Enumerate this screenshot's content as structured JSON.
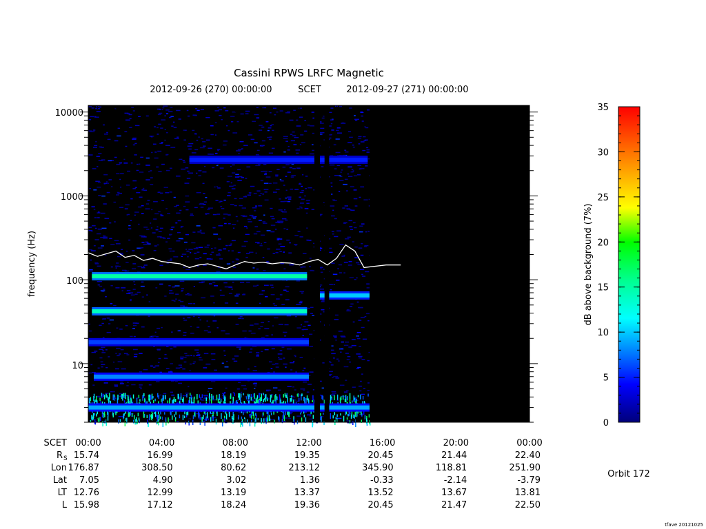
{
  "header": {
    "title": "Cassini RPWS LRFC Magnetic",
    "start_time": "2012-09-26 (270) 00:00:00",
    "time_system": "SCET",
    "end_time": "2012-09-27 (271) 00:00:00"
  },
  "colorbar": {
    "label": "dB above background (7%)",
    "ticks": [
      "0",
      "5",
      "10",
      "15",
      "20",
      "25",
      "30",
      "35"
    ],
    "range": [
      0,
      35
    ]
  },
  "orbit_label": "Orbit 172",
  "footer_credit": "tfave 20121025",
  "ephemeris": {
    "row_labels": {
      "scet": "SCET",
      "rs_main": "R",
      "rs_sub": "S",
      "lon": "Lon",
      "lat": "Lat",
      "lt": "LT",
      "l": "L"
    },
    "columns": [
      {
        "scet": "00:00",
        "rs": "15.74",
        "lon": "176.87",
        "lat": "7.05",
        "lt": "12.76",
        "l": "15.98"
      },
      {
        "scet": "04:00",
        "rs": "16.99",
        "lon": "308.50",
        "lat": "4.90",
        "lt": "12.99",
        "l": "17.12"
      },
      {
        "scet": "08:00",
        "rs": "18.19",
        "lon": "80.62",
        "lat": "3.02",
        "lt": "13.19",
        "l": "18.24"
      },
      {
        "scet": "12:00",
        "rs": "19.35",
        "lon": "213.12",
        "lat": "1.36",
        "lt": "13.37",
        "l": "19.36"
      },
      {
        "scet": "16:00",
        "rs": "20.45",
        "lon": "345.90",
        "lat": "-0.33",
        "lt": "13.52",
        "l": "20.45"
      },
      {
        "scet": "20:00",
        "rs": "21.44",
        "lon": "118.81",
        "lat": "-2.14",
        "lt": "13.67",
        "l": "21.47"
      },
      {
        "scet": "00:00",
        "rs": "22.40",
        "lon": "251.90",
        "lat": "-3.79",
        "lt": "13.81",
        "l": "22.50"
      }
    ]
  },
  "chart_data": {
    "type": "heatmap",
    "title": "Cassini RPWS LRFC Magnetic",
    "xlabel": "",
    "ylabel": "frequency (Hz)",
    "y_scale": "log",
    "ylim": [
      2,
      12000
    ],
    "xlim_hours": [
      0,
      24
    ],
    "x_ticks": [
      "00:00",
      "04:00",
      "08:00",
      "12:00",
      "16:00",
      "20:00",
      "00:00"
    ],
    "y_ticks": [
      "10",
      "100",
      "1000",
      "10000"
    ],
    "bands": [
      {
        "freq_hz": 110,
        "t_start_h": 0.2,
        "t_end_h": 11.9,
        "level_db": 15
      },
      {
        "freq_hz": 42,
        "t_start_h": 0.2,
        "t_end_h": 11.9,
        "level_db": 14
      },
      {
        "freq_hz": 18,
        "t_start_h": 0.0,
        "t_end_h": 12.0,
        "level_db": 6
      },
      {
        "freq_hz": 7,
        "t_start_h": 0.3,
        "t_end_h": 12.0,
        "level_db": 8
      },
      {
        "freq_hz": 3,
        "t_start_h": 0.0,
        "t_end_h": 15.3,
        "level_db": 9
      },
      {
        "freq_hz": 65,
        "t_start_h": 12.4,
        "t_end_h": 15.3,
        "level_db": 10
      },
      {
        "freq_hz": 2700,
        "t_start_h": 5.5,
        "t_end_h": 15.2,
        "level_db": 5
      }
    ],
    "data_gaps_h": [
      [
        12.3,
        12.6
      ],
      [
        12.85,
        13.1
      ],
      [
        15.3,
        24.0
      ]
    ],
    "white_trace": {
      "t_h": [
        0,
        0.5,
        1,
        1.5,
        2,
        2.5,
        3,
        3.5,
        4,
        4.5,
        5,
        5.5,
        6,
        6.5,
        7,
        7.5,
        8,
        8.5,
        9,
        9.5,
        10,
        10.5,
        11,
        11.5,
        12,
        12.5,
        13,
        13.5,
        14,
        14.5,
        15,
        16.2,
        17
      ],
      "freq_hz": [
        210,
        190,
        205,
        220,
        185,
        195,
        170,
        180,
        165,
        160,
        155,
        140,
        150,
        155,
        145,
        135,
        150,
        165,
        158,
        162,
        155,
        160,
        158,
        150,
        165,
        175,
        150,
        180,
        260,
        220,
        140,
        150,
        150
      ]
    },
    "colorbar_range_db": [
      0,
      35
    ]
  }
}
